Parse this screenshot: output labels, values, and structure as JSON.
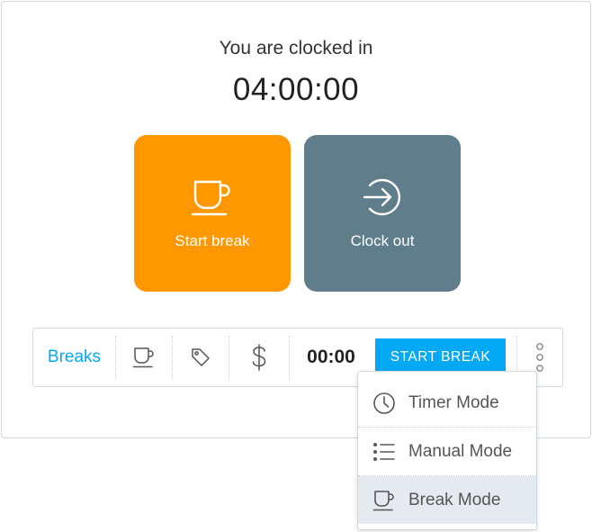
{
  "status": {
    "label": "You are clocked in",
    "elapsed": "04:00:00"
  },
  "actions": {
    "start_break": {
      "label": "Start break",
      "icon": "coffee-cup-icon",
      "color": "#ff9800"
    },
    "clock_out": {
      "label": "Clock out",
      "icon": "arrow-right-circle-icon",
      "color": "#607d8b"
    }
  },
  "toolbar": {
    "mode_label": "Breaks",
    "icons": [
      "coffee-cup-icon",
      "tag-icon",
      "dollar-icon"
    ],
    "timer": "00:00",
    "start_button": "START BREAK",
    "more_icon": "vertical-dots-icon",
    "accent": "#03a9f4"
  },
  "mode_menu": {
    "items": [
      {
        "label": "Timer Mode",
        "icon": "clock-icon",
        "active": false
      },
      {
        "label": "Manual Mode",
        "icon": "list-icon",
        "active": false
      },
      {
        "label": "Break Mode",
        "icon": "coffee-cup-icon",
        "active": true
      }
    ]
  }
}
